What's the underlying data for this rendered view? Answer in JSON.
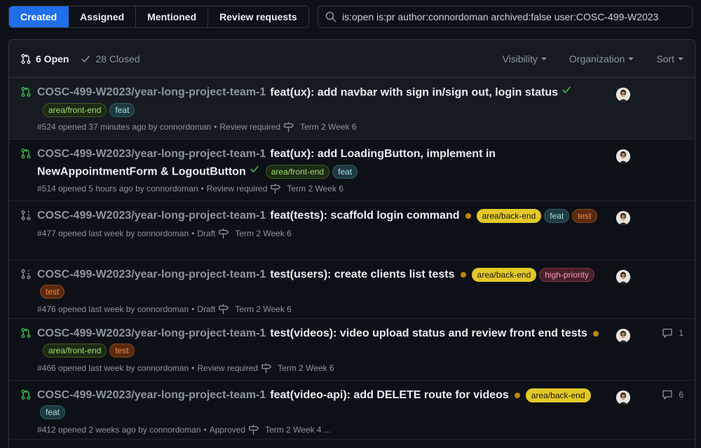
{
  "tabs": [
    {
      "label": "Created",
      "active": true
    },
    {
      "label": "Assigned",
      "active": false
    },
    {
      "label": "Mentioned",
      "active": false
    },
    {
      "label": "Review requests",
      "active": false
    }
  ],
  "search": {
    "value": "is:open is:pr author:connordoman archived:false user:COSC-499-W2023"
  },
  "header": {
    "open_label": "6 Open",
    "closed_label": "28 Closed",
    "filters": [
      "Visibility",
      "Organization",
      "Sort"
    ]
  },
  "colors": {
    "accent": "#1f6feb",
    "open_green": "#3fb950",
    "draft_gray": "#8b949e",
    "pending_dot": "#bf8700"
  },
  "label_styles": {
    "area/front-end": {
      "bg": "#1c2a14",
      "fg": "#a5d96e",
      "border": "#3c5a20"
    },
    "area/back-end": {
      "bg": "#e3c82a",
      "fg": "#1a1600",
      "border": "#e3c82a"
    },
    "feat": {
      "bg": "#1f3a3f",
      "fg": "#a8dde5",
      "border": "#2f5a61"
    },
    "test": {
      "bg": "#5a2a10",
      "fg": "#f08a4b",
      "border": "#8a4318"
    },
    "high-priority": {
      "bg": "#4a1f2a",
      "fg": "#f29bb0",
      "border": "#7a3346"
    }
  },
  "pull_requests": [
    {
      "state": "open",
      "repo": "COSC-499-W2023/year-long-project-team-1",
      "title": "feat(ux): add navbar with sign in/sign out, login status",
      "status": "success",
      "labels": [
        "area/front-end",
        "feat"
      ],
      "meta": "#524 opened 37 minutes ago by connordoman",
      "review": "Review required",
      "milestone": "Term 2 Week 6",
      "comments": ""
    },
    {
      "state": "open",
      "repo": "COSC-499-W2023/year-long-project-team-1",
      "title": "feat(ux): add LoadingButton, implement in NewAppointmentForm & LogoutButton",
      "status": "success",
      "labels": [
        "area/front-end",
        "feat"
      ],
      "meta": "#514 opened 5 hours ago by connordoman",
      "review": "Review required",
      "milestone": "Term 2 Week 6",
      "comments": ""
    },
    {
      "state": "draft",
      "repo": "COSC-499-W2023/year-long-project-team-1",
      "title": "feat(tests): scaffold login command",
      "status": "pending",
      "labels": [
        "area/back-end",
        "feat",
        "test"
      ],
      "meta": "#477 opened last week by connordoman",
      "review": "Draft",
      "milestone": "Term 2 Week 6",
      "comments": ""
    },
    {
      "state": "draft",
      "repo": "COSC-499-W2023/year-long-project-team-1",
      "title": "test(users): create clients list tests",
      "status": "pending",
      "labels": [
        "area/back-end",
        "high-priority",
        "test"
      ],
      "meta": "#476 opened last week by connordoman",
      "review": "Draft",
      "milestone": "Term 2 Week 6",
      "comments": ""
    },
    {
      "state": "open",
      "repo": "COSC-499-W2023/year-long-project-team-1",
      "title": "test(videos): video upload status and review front end tests",
      "status": "pending",
      "labels": [
        "area/front-end",
        "test"
      ],
      "meta": "#466 opened last week by connordoman",
      "review": "Review required",
      "milestone": "Term 2 Week 6",
      "comments": "1"
    },
    {
      "state": "open",
      "repo": "COSC-499-W2023/year-long-project-team-1",
      "title": "feat(video-api): add DELETE route for videos",
      "status": "pending",
      "labels": [
        "area/back-end",
        "feat"
      ],
      "meta": "#412 opened 2 weeks ago by connordoman",
      "review": "Approved",
      "milestone": "Term 2 Week 4 ...",
      "comments": "6"
    }
  ]
}
